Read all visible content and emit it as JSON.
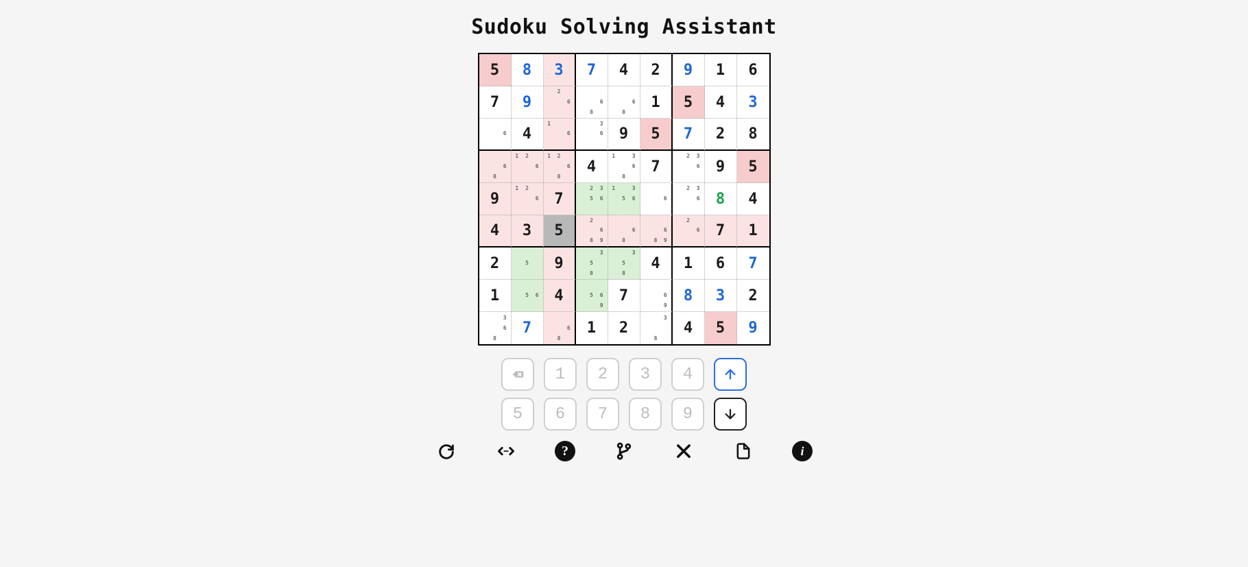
{
  "title": "Sudoku Solving Assistant",
  "colors": {
    "given": "#1a1a1a",
    "user_blue": "#1c66d6",
    "user_green": "#17a34a",
    "highlight_pink": "#f7cccc",
    "highlight_pink_light": "#fbe3e3",
    "highlight_green": "#daf0d6",
    "highlight_gray": "#b8b8b8"
  },
  "board": [
    [
      {
        "v": "5",
        "c": "given",
        "hl": "pink"
      },
      {
        "v": "8",
        "c": "blue"
      },
      {
        "v": "3",
        "c": "blue",
        "hl": "pink-l"
      },
      {
        "v": "7",
        "c": "blue"
      },
      {
        "v": "4",
        "c": "given"
      },
      {
        "v": "2",
        "c": "given"
      },
      {
        "v": "9",
        "c": "blue"
      },
      {
        "v": "1",
        "c": "given"
      },
      {
        "v": "6",
        "c": "given"
      }
    ],
    [
      {
        "v": "7",
        "c": "given"
      },
      {
        "v": "9",
        "c": "blue"
      },
      {
        "pm": [
          2,
          6
        ],
        "hl": "pink-l"
      },
      {
        "pm": [
          6,
          8
        ]
      },
      {
        "pm": [
          6,
          8
        ]
      },
      {
        "v": "1",
        "c": "given"
      },
      {
        "v": "5",
        "c": "given",
        "hl": "pink"
      },
      {
        "v": "4",
        "c": "given"
      },
      {
        "v": "3",
        "c": "blue"
      }
    ],
    [
      {
        "pm": [
          6
        ]
      },
      {
        "v": "4",
        "c": "given"
      },
      {
        "pm": [
          1,
          6
        ],
        "hl": "pink-l"
      },
      {
        "pm": [
          3,
          6
        ]
      },
      {
        "v": "9",
        "c": "given"
      },
      {
        "v": "5",
        "c": "given",
        "hl": "pink"
      },
      {
        "v": "7",
        "c": "blue"
      },
      {
        "v": "2",
        "c": "given"
      },
      {
        "v": "8",
        "c": "given"
      }
    ],
    [
      {
        "pm": [
          6,
          8
        ],
        "hl": "pink-l"
      },
      {
        "pm": [
          1,
          2,
          6
        ],
        "hl": "pink-l"
      },
      {
        "pm": [
          1,
          2,
          6,
          8
        ],
        "hl": "pink-l"
      },
      {
        "v": "4",
        "c": "given"
      },
      {
        "pm": [
          1,
          3,
          6,
          8
        ]
      },
      {
        "v": "7",
        "c": "given"
      },
      {
        "pm": [
          2,
          3,
          6
        ]
      },
      {
        "v": "9",
        "c": "given"
      },
      {
        "v": "5",
        "c": "given",
        "hl": "pink"
      }
    ],
    [
      {
        "v": "9",
        "c": "given",
        "hl": "pink-l"
      },
      {
        "pm": [
          1,
          2,
          6
        ],
        "hl": "pink-l"
      },
      {
        "v": "7",
        "c": "given",
        "hl": "pink-l"
      },
      {
        "pm": [
          2,
          3,
          5,
          6
        ],
        "hl": "green"
      },
      {
        "pm": [
          1,
          3,
          5,
          6
        ],
        "hl": "green"
      },
      {
        "pm": [
          6
        ]
      },
      {
        "pm": [
          2,
          3,
          6
        ]
      },
      {
        "v": "8",
        "c": "green"
      },
      {
        "v": "4",
        "c": "given"
      }
    ],
    [
      {
        "v": "4",
        "c": "given",
        "hl": "pink-l"
      },
      {
        "v": "3",
        "c": "given",
        "hl": "pink-l"
      },
      {
        "v": "5",
        "c": "given",
        "hl": "gray"
      },
      {
        "pm": [
          2,
          6,
          8,
          9
        ],
        "hl": "pink-l"
      },
      {
        "pm": [
          6,
          8
        ],
        "hl": "pink-l"
      },
      {
        "pm": [
          6,
          8,
          9
        ],
        "hl": "pink-l"
      },
      {
        "pm": [
          2,
          6
        ],
        "hl": "pink-l"
      },
      {
        "v": "7",
        "c": "given",
        "hl": "pink-l"
      },
      {
        "v": "1",
        "c": "given",
        "hl": "pink-l"
      }
    ],
    [
      {
        "v": "2",
        "c": "given"
      },
      {
        "pm": [
          5
        ],
        "hl": "green"
      },
      {
        "v": "9",
        "c": "given",
        "hl": "pink-l"
      },
      {
        "pm": [
          3,
          5,
          8
        ],
        "hl": "green"
      },
      {
        "pm": [
          3,
          5,
          8
        ],
        "hl": "green"
      },
      {
        "v": "4",
        "c": "given"
      },
      {
        "v": "1",
        "c": "given"
      },
      {
        "v": "6",
        "c": "given"
      },
      {
        "v": "7",
        "c": "blue"
      }
    ],
    [
      {
        "v": "1",
        "c": "given"
      },
      {
        "pm": [
          5,
          6
        ],
        "hl": "green"
      },
      {
        "v": "4",
        "c": "given",
        "hl": "pink-l"
      },
      {
        "pm": [
          5,
          6,
          9
        ],
        "hl": "green"
      },
      {
        "v": "7",
        "c": "given"
      },
      {
        "pm": [
          6,
          9
        ]
      },
      {
        "v": "8",
        "c": "blue"
      },
      {
        "v": "3",
        "c": "blue"
      },
      {
        "v": "2",
        "c": "given"
      }
    ],
    [
      {
        "pm": [
          3,
          6,
          8
        ]
      },
      {
        "v": "7",
        "c": "blue"
      },
      {
        "pm": [
          6,
          8
        ],
        "hl": "pink-l"
      },
      {
        "v": "1",
        "c": "given"
      },
      {
        "v": "2",
        "c": "given"
      },
      {
        "pm": [
          3,
          8
        ]
      },
      {
        "v": "4",
        "c": "given"
      },
      {
        "v": "5",
        "c": "given",
        "hl": "pink"
      },
      {
        "v": "9",
        "c": "blue"
      }
    ]
  ],
  "numpad": {
    "labels": [
      "1",
      "2",
      "3",
      "4",
      "5",
      "6",
      "7",
      "8",
      "9"
    ],
    "backspace_icon": "backspace",
    "up_icon": "arrow-up",
    "down_icon": "arrow-down",
    "up_active": true
  },
  "toolbar": [
    {
      "name": "redo",
      "icon": "redo"
    },
    {
      "name": "embed",
      "icon": "code-dots"
    },
    {
      "name": "help",
      "icon": "question-circle"
    },
    {
      "name": "branch",
      "icon": "git-branch"
    },
    {
      "name": "close",
      "icon": "x"
    },
    {
      "name": "file",
      "icon": "file"
    },
    {
      "name": "info",
      "icon": "info-circle"
    }
  ]
}
